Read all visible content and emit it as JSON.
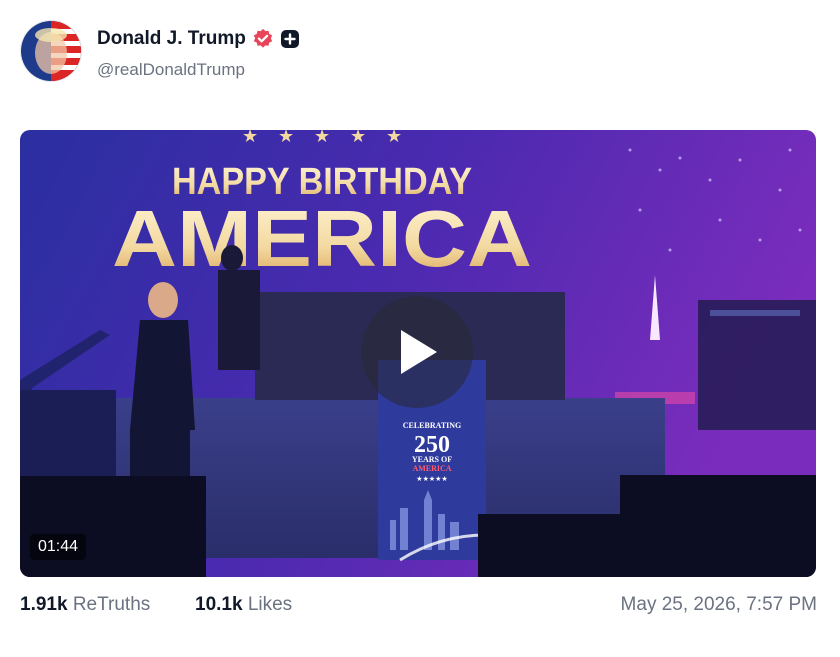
{
  "post": {
    "display_name": "Donald J. Trump",
    "handle": "@realDonaldTrump",
    "video": {
      "duration": "01:44",
      "banner_line1": "HAPPY BIRTHDAY",
      "banner_line2": "AMERICA",
      "podium_line1": "CELEBRATING",
      "podium_line2": "250",
      "podium_line3": "YEARS OF",
      "podium_line4": "AMERICA",
      "podium_stars": "★★★★★"
    },
    "retruths_count": "1.91k",
    "retruths_label": "ReTruths",
    "likes_count": "10.1k",
    "likes_label": "Likes",
    "timestamp": "May 25, 2026, 7:57 PM"
  },
  "colors": {
    "verified": "#e8455a",
    "stage_bg": "#3b2aa8",
    "banner_gold": "#f3d9a0"
  },
  "icons": [
    "verified-badge-icon",
    "plus-badge-icon",
    "play-icon"
  ]
}
